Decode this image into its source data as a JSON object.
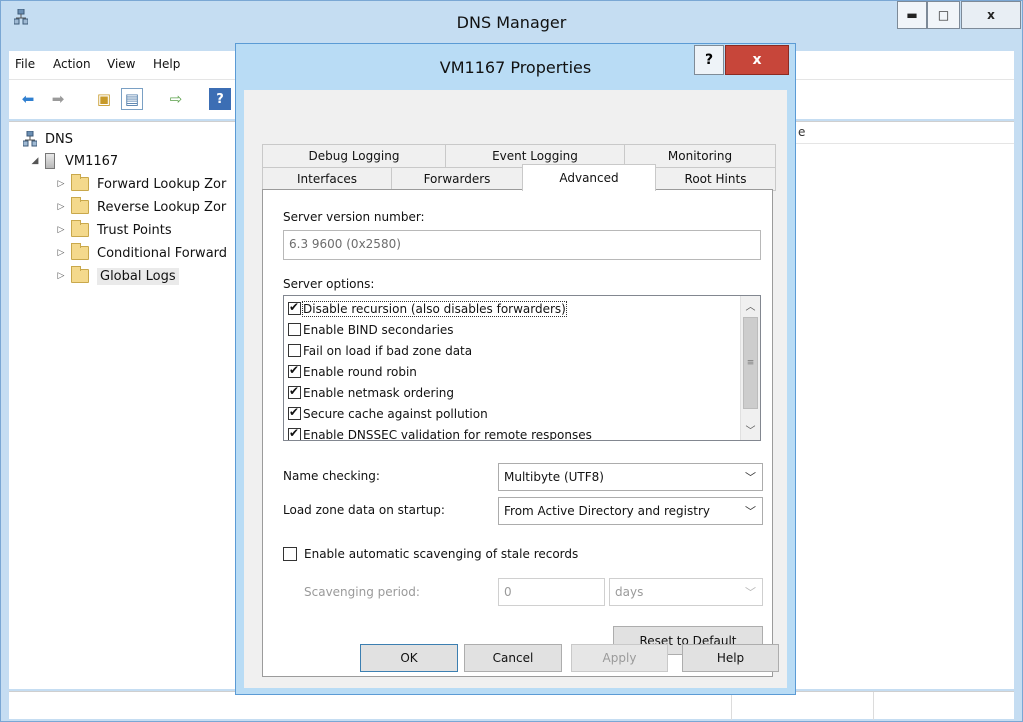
{
  "main_window": {
    "title": "DNS Manager",
    "controls": {
      "minimize": "▬",
      "maximize": "□",
      "close": "x"
    }
  },
  "menu": {
    "items": [
      "File",
      "Action",
      "View",
      "Help"
    ]
  },
  "toolbar": {
    "icons": [
      "back-arrow-icon",
      "forward-arrow-icon",
      "folder-up-icon",
      "show-hide-tree-icon",
      "export-list-icon",
      "help-icon"
    ]
  },
  "tree": {
    "root": "DNS",
    "server": "VM1167",
    "children": [
      "Forward Lookup Zor",
      "Reverse Lookup Zor",
      "Trust Points",
      "Conditional Forward",
      "Global Logs"
    ],
    "expander": "▷",
    "expanded": "◢"
  },
  "right_pane": {
    "header_fragment": "e"
  },
  "dialog": {
    "title": "VM1167 Properties",
    "help_btn": "?",
    "close_btn": "x",
    "tabs_back": [
      "Debug Logging",
      "Event Logging",
      "Monitoring"
    ],
    "tabs_front": [
      "Interfaces",
      "Forwarders",
      "Advanced",
      "Root Hints"
    ],
    "active_tab": "Advanced",
    "advanced": {
      "version_label": "Server version number:",
      "version_value": "6.3 9600 (0x2580)",
      "options_label": "Server options:",
      "options": [
        {
          "label": "Disable recursion (also disables forwarders)",
          "checked": true
        },
        {
          "label": "Enable BIND secondaries",
          "checked": false
        },
        {
          "label": "Fail on load if bad zone data",
          "checked": false
        },
        {
          "label": "Enable round robin",
          "checked": true
        },
        {
          "label": "Enable netmask ordering",
          "checked": true
        },
        {
          "label": "Secure cache against pollution",
          "checked": true
        },
        {
          "label": "Enable DNSSEC validation for remote responses",
          "checked": true
        }
      ],
      "name_checking_label": "Name checking:",
      "name_checking_value": "Multibyte (UTF8)",
      "load_zone_label": "Load zone data on startup:",
      "load_zone_value": "From Active Directory and registry",
      "scavenging_label": "Enable automatic scavenging of stale records",
      "scavenging_checked": false,
      "scavenging_period_label": "Scavenging period:",
      "scavenging_period_value": "0",
      "scavenging_unit": "days",
      "reset_button": "Reset to Default"
    },
    "buttons": {
      "ok": "OK",
      "cancel": "Cancel",
      "apply": "Apply",
      "help": "Help"
    }
  }
}
